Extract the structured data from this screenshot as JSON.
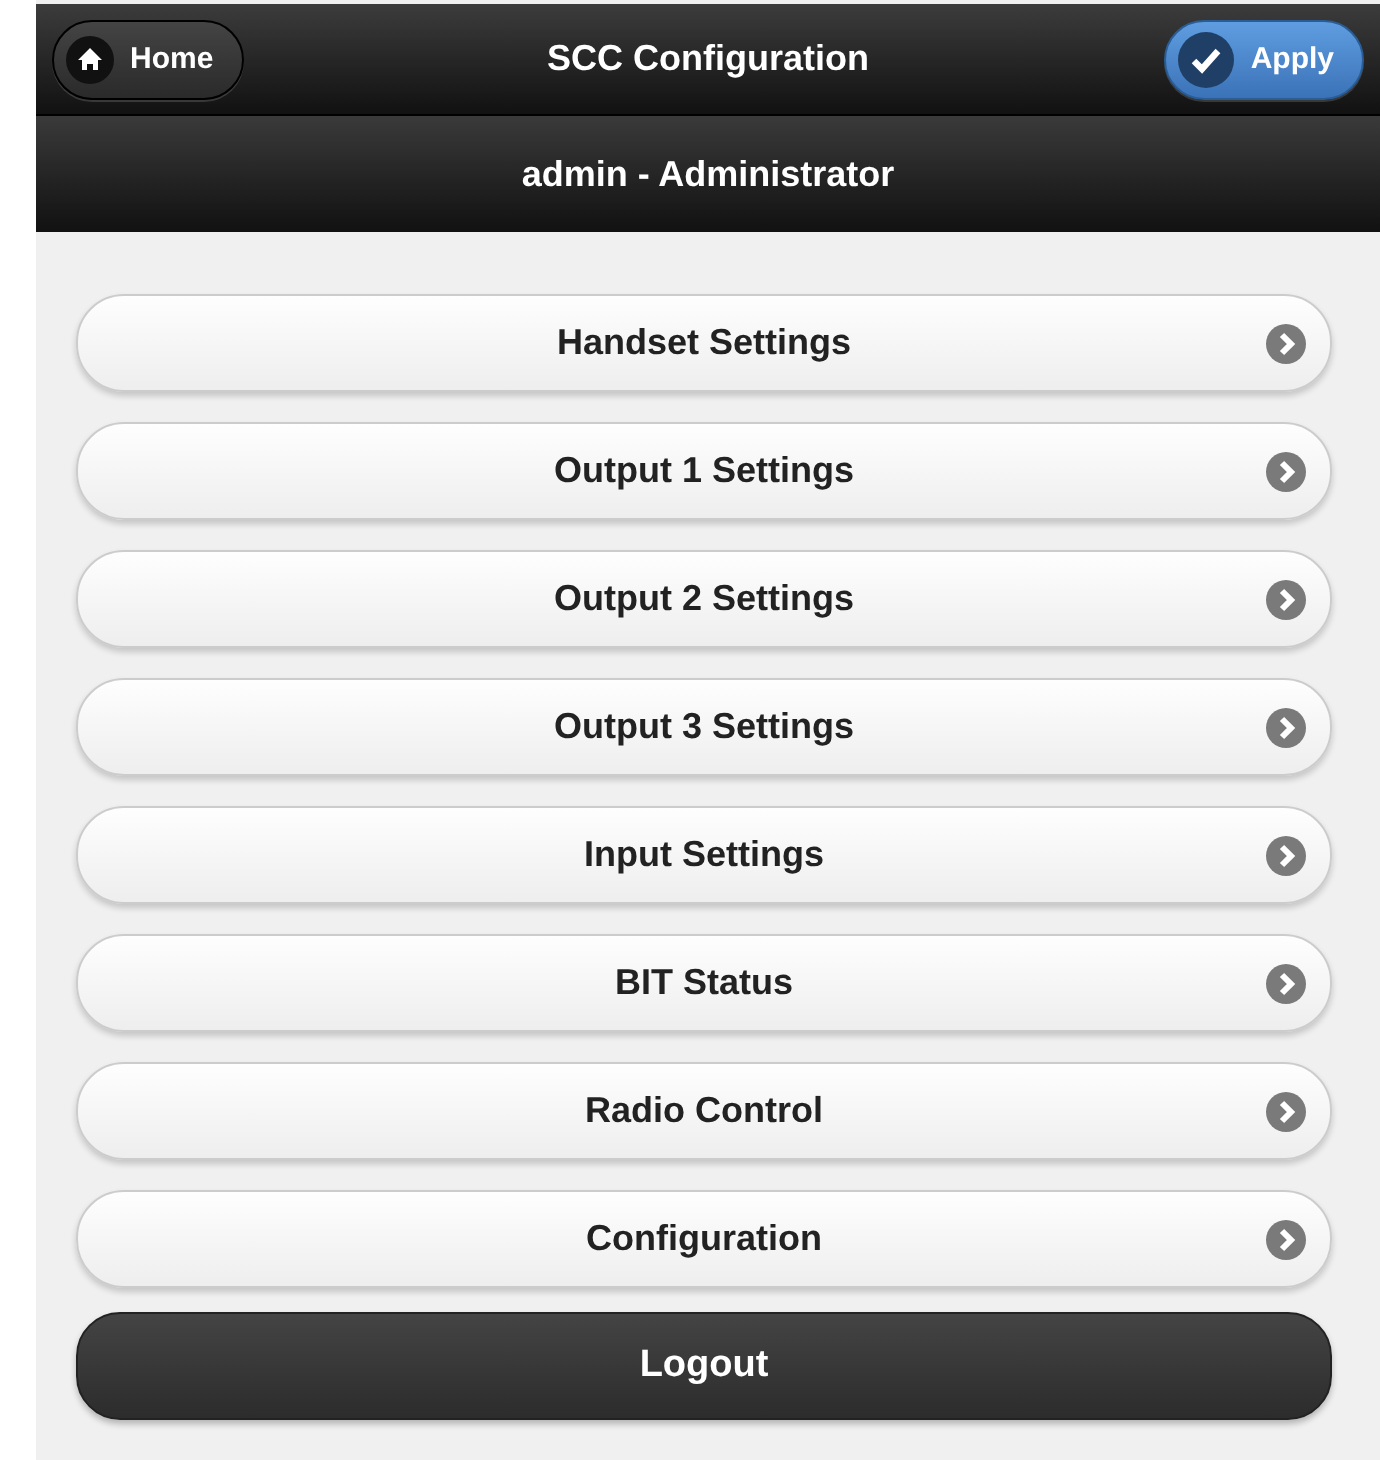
{
  "header": {
    "home_button": "Home",
    "title": "SCC Configuration",
    "apply_button": "Apply"
  },
  "subheader": {
    "user": "admin - Administrator"
  },
  "menu_items": [
    {
      "label": "Handset Settings"
    },
    {
      "label": "Output 1 Settings"
    },
    {
      "label": "Output 2 Settings"
    },
    {
      "label": "Output 3 Settings"
    },
    {
      "label": "Input Settings"
    },
    {
      "label": "BIT Status"
    },
    {
      "label": "Radio Control"
    },
    {
      "label": "Configuration"
    }
  ],
  "logout_button": "Logout"
}
